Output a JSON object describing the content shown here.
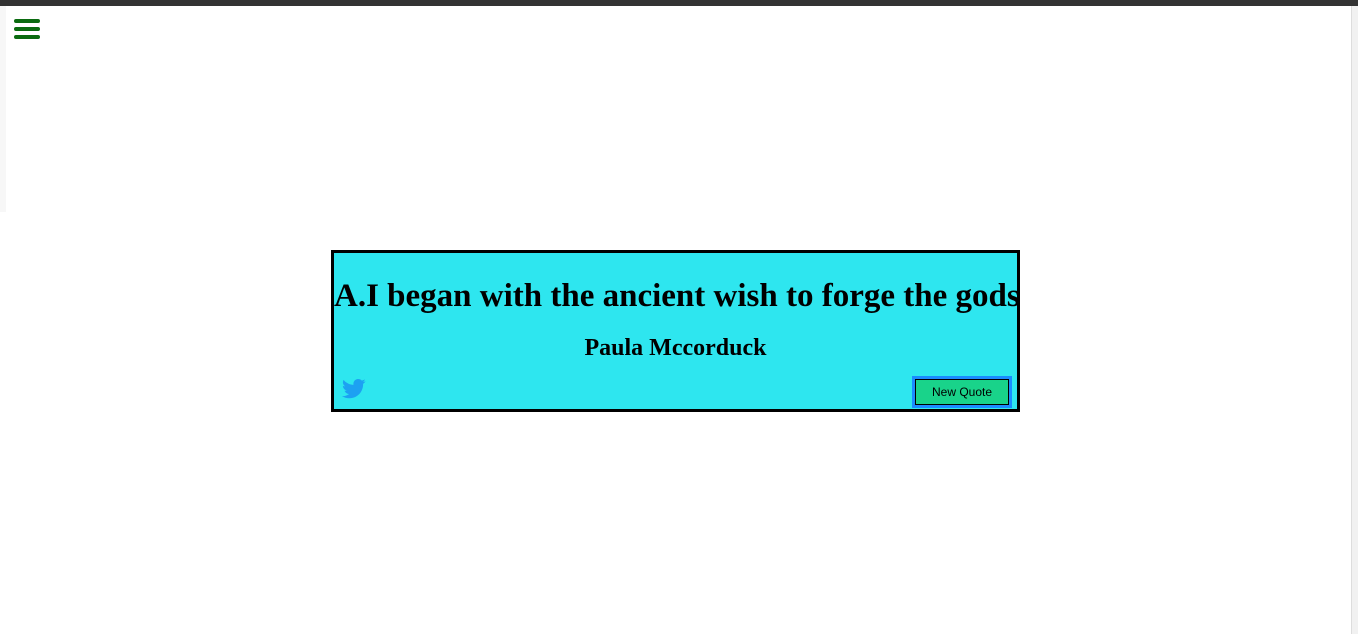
{
  "nav": {
    "menu_icon": "hamburger-menu-icon",
    "menu_color": "#0b6b10"
  },
  "quote": {
    "text": "A.I began with the ancient wish to forge the gods",
    "author": "Paula Mccorduck",
    "background_color": "#2ee6ef"
  },
  "actions": {
    "twitter_icon": "twitter-icon",
    "twitter_color": "#1da1f2",
    "new_quote_label": "New Quote",
    "new_quote_color": "#19d38a"
  }
}
